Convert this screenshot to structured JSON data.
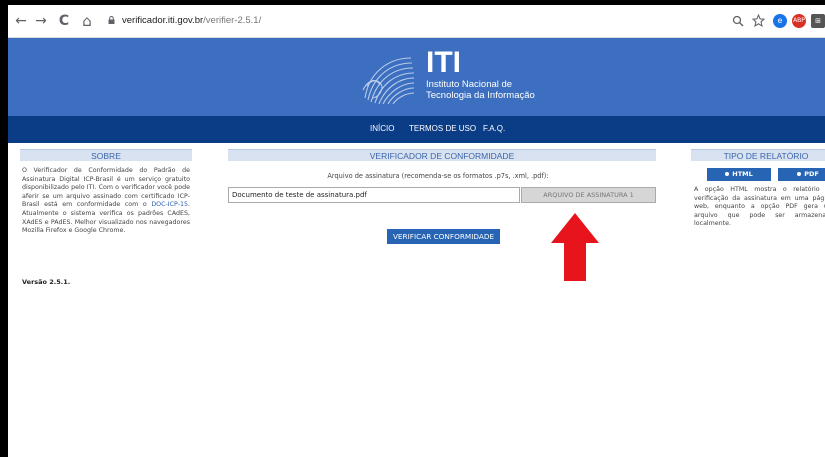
{
  "browser": {
    "url_host": "verificador.iti.gov.br",
    "url_path": "/verifier-2.5.1/",
    "nav": {
      "back": "←",
      "forward": "→",
      "reload": "C",
      "home": "⌂"
    },
    "toolbar_icons": [
      "zoom-icon",
      "star-icon",
      "extension-e-icon",
      "extension-abp-icon",
      "extension-dict-icon"
    ]
  },
  "banner": {
    "logo_text": "ITI",
    "logo_sub_line1": "Instituto Nacional de",
    "logo_sub_line2": "Tecnologia da Informação",
    "color": "#3c6fbf"
  },
  "menu": {
    "items": [
      "INÍCIO",
      "TERMOS DE USO",
      "F.A.Q."
    ],
    "color": "#0b3d87"
  },
  "sobre": {
    "heading": "SOBRE",
    "text_before_link": "O Verificador de Conformidade do Padrão de Assinatura Digital ICP-Brasil é um serviço gratuito disponibilizado pelo ITI. Com o verificador você pode aferir se um arquivo assinado com certificado ICP-Brasil está em conformidade com o ",
    "link": "DOC-ICP-15",
    "text_after_link": ". Atualmente o sistema verifica os padrões CAdES, XAdES e PAdES. Melhor visualizado nos navegadores Mozilla Firefox e Google Chrome.",
    "version": "Versão 2.5.1."
  },
  "verificador": {
    "heading": "VERIFICADOR DE CONFORMIDADE",
    "file_label": "Arquivo de assinatura (recomenda-se os formatos .p7s, .xml, .pdf):",
    "file_value": "Documento de teste de assinatura.pdf",
    "file_button": "ARQUIVO DE ASSINATURA 1",
    "verify_button": "VERIFICAR CONFORMIDADE"
  },
  "tipo": {
    "heading": "TIPO DE RELATÓRIO",
    "html_button": "HTML",
    "pdf_button": "PDF",
    "text": "A opção HTML mostra o relatório de verificação da assinatura em uma página web, enquanto a opção PDF gera um arquivo que pode ser armazenado localmente."
  },
  "annotation": {
    "arrow_color": "#e8141c"
  }
}
